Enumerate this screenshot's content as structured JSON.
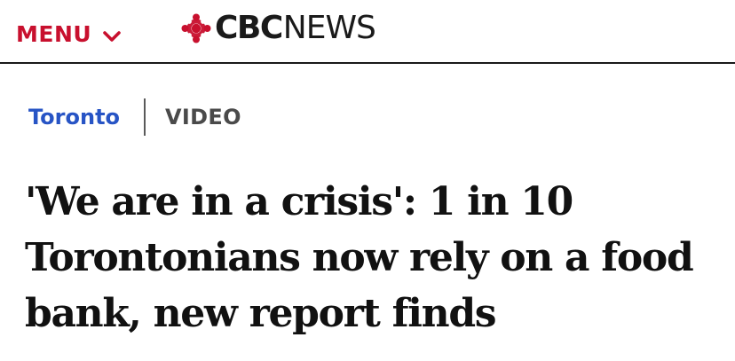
{
  "header": {
    "menu_label": "MENU",
    "menu_icon": "chevron-down-icon",
    "logo": {
      "brand": "CBC",
      "section": "NEWS",
      "icon": "cbc-gem-icon"
    },
    "brand_color": "#c8102e"
  },
  "breadcrumb": {
    "section": "Toronto",
    "section_color": "#2754c5",
    "content_type": "VIDEO"
  },
  "article": {
    "headline": "'We are in a crisis': 1 in 10 Torontonians now rely on a food bank, new report finds"
  }
}
